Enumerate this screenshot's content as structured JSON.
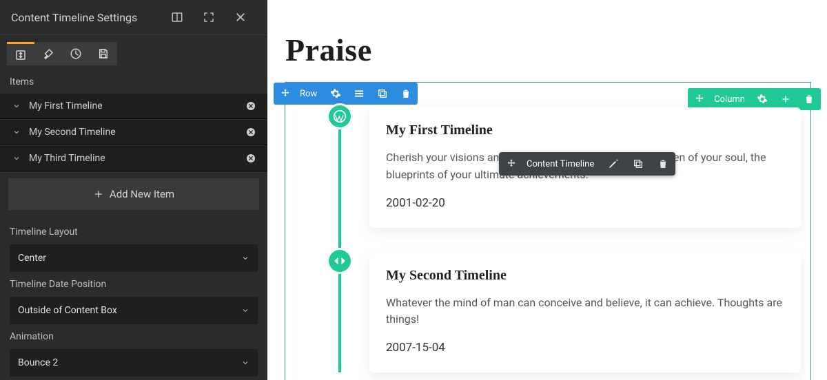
{
  "sidebar": {
    "title": "Content Timeline Settings",
    "items_label": "Items",
    "items": [
      {
        "label": "My First Timeline"
      },
      {
        "label": "My Second Timeline"
      },
      {
        "label": "My Third Timeline"
      }
    ],
    "add_button": "Add New Item",
    "fields": {
      "layout": {
        "label": "Timeline Layout",
        "value": "Center"
      },
      "date_position": {
        "label": "Timeline Date Position",
        "value": "Outside of Content Box"
      },
      "animation": {
        "label": "Animation",
        "value": "Bounce 2"
      }
    }
  },
  "canvas": {
    "heading": "Praise",
    "row_label": "Row",
    "column_label": "Column",
    "element_label": "Content Timeline",
    "timeline": [
      {
        "title": "My First Timeline",
        "body": "Cherish your visions and your dreams as they are the children of your soul, the blueprints of your ultimate achievements.",
        "date": "2001-02-20"
      },
      {
        "title": "My Second Timeline",
        "body": "Whatever the mind of man can conceive and believe, it can achieve. Thoughts are things!",
        "date": "2007-15-04"
      }
    ]
  },
  "colors": {
    "accent_blue": "#2c8ce0",
    "accent_teal": "#20c997",
    "panel_bg": "#2b2b2b"
  }
}
